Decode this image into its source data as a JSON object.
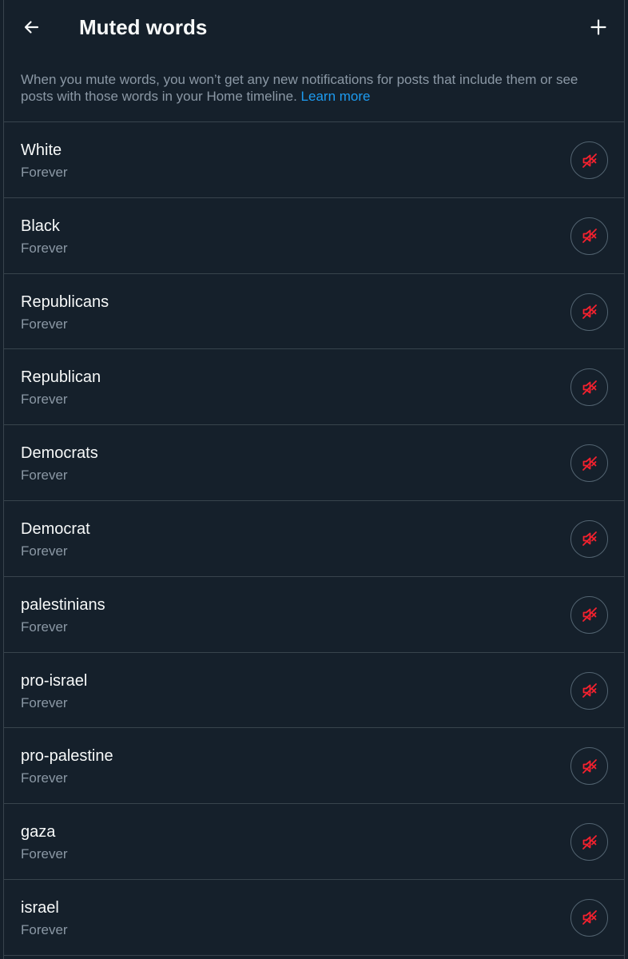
{
  "header": {
    "title": "Muted words",
    "back_icon": "arrow-left-icon",
    "add_icon": "plus-icon"
  },
  "description": {
    "text": "When you mute words, you won’t get any new notifications for posts that include them or see posts with those words in your Home timeline.",
    "link_label": "Learn more"
  },
  "colors": {
    "background": "#15202b",
    "text_primary": "#f7f9f9",
    "text_secondary": "#8b98a5",
    "link": "#1d9bf0",
    "border": "#38444d",
    "mute_icon": "#f4212e"
  },
  "muted_words": [
    {
      "word": "White",
      "duration": "Forever",
      "icon": "speaker-muted-icon"
    },
    {
      "word": "Black",
      "duration": "Forever",
      "icon": "speaker-muted-icon"
    },
    {
      "word": "Republicans",
      "duration": "Forever",
      "icon": "speaker-muted-icon"
    },
    {
      "word": "Republican",
      "duration": "Forever",
      "icon": "speaker-muted-icon"
    },
    {
      "word": "Democrats",
      "duration": "Forever",
      "icon": "speaker-muted-icon"
    },
    {
      "word": "Democrat",
      "duration": "Forever",
      "icon": "speaker-muted-icon"
    },
    {
      "word": "palestinians",
      "duration": "Forever",
      "icon": "speaker-muted-icon"
    },
    {
      "word": "pro-israel",
      "duration": "Forever",
      "icon": "speaker-muted-icon"
    },
    {
      "word": "pro-palestine",
      "duration": "Forever",
      "icon": "speaker-muted-icon"
    },
    {
      "word": "gaza",
      "duration": "Forever",
      "icon": "speaker-muted-icon"
    },
    {
      "word": "israel",
      "duration": "Forever",
      "icon": "speaker-muted-icon"
    }
  ]
}
